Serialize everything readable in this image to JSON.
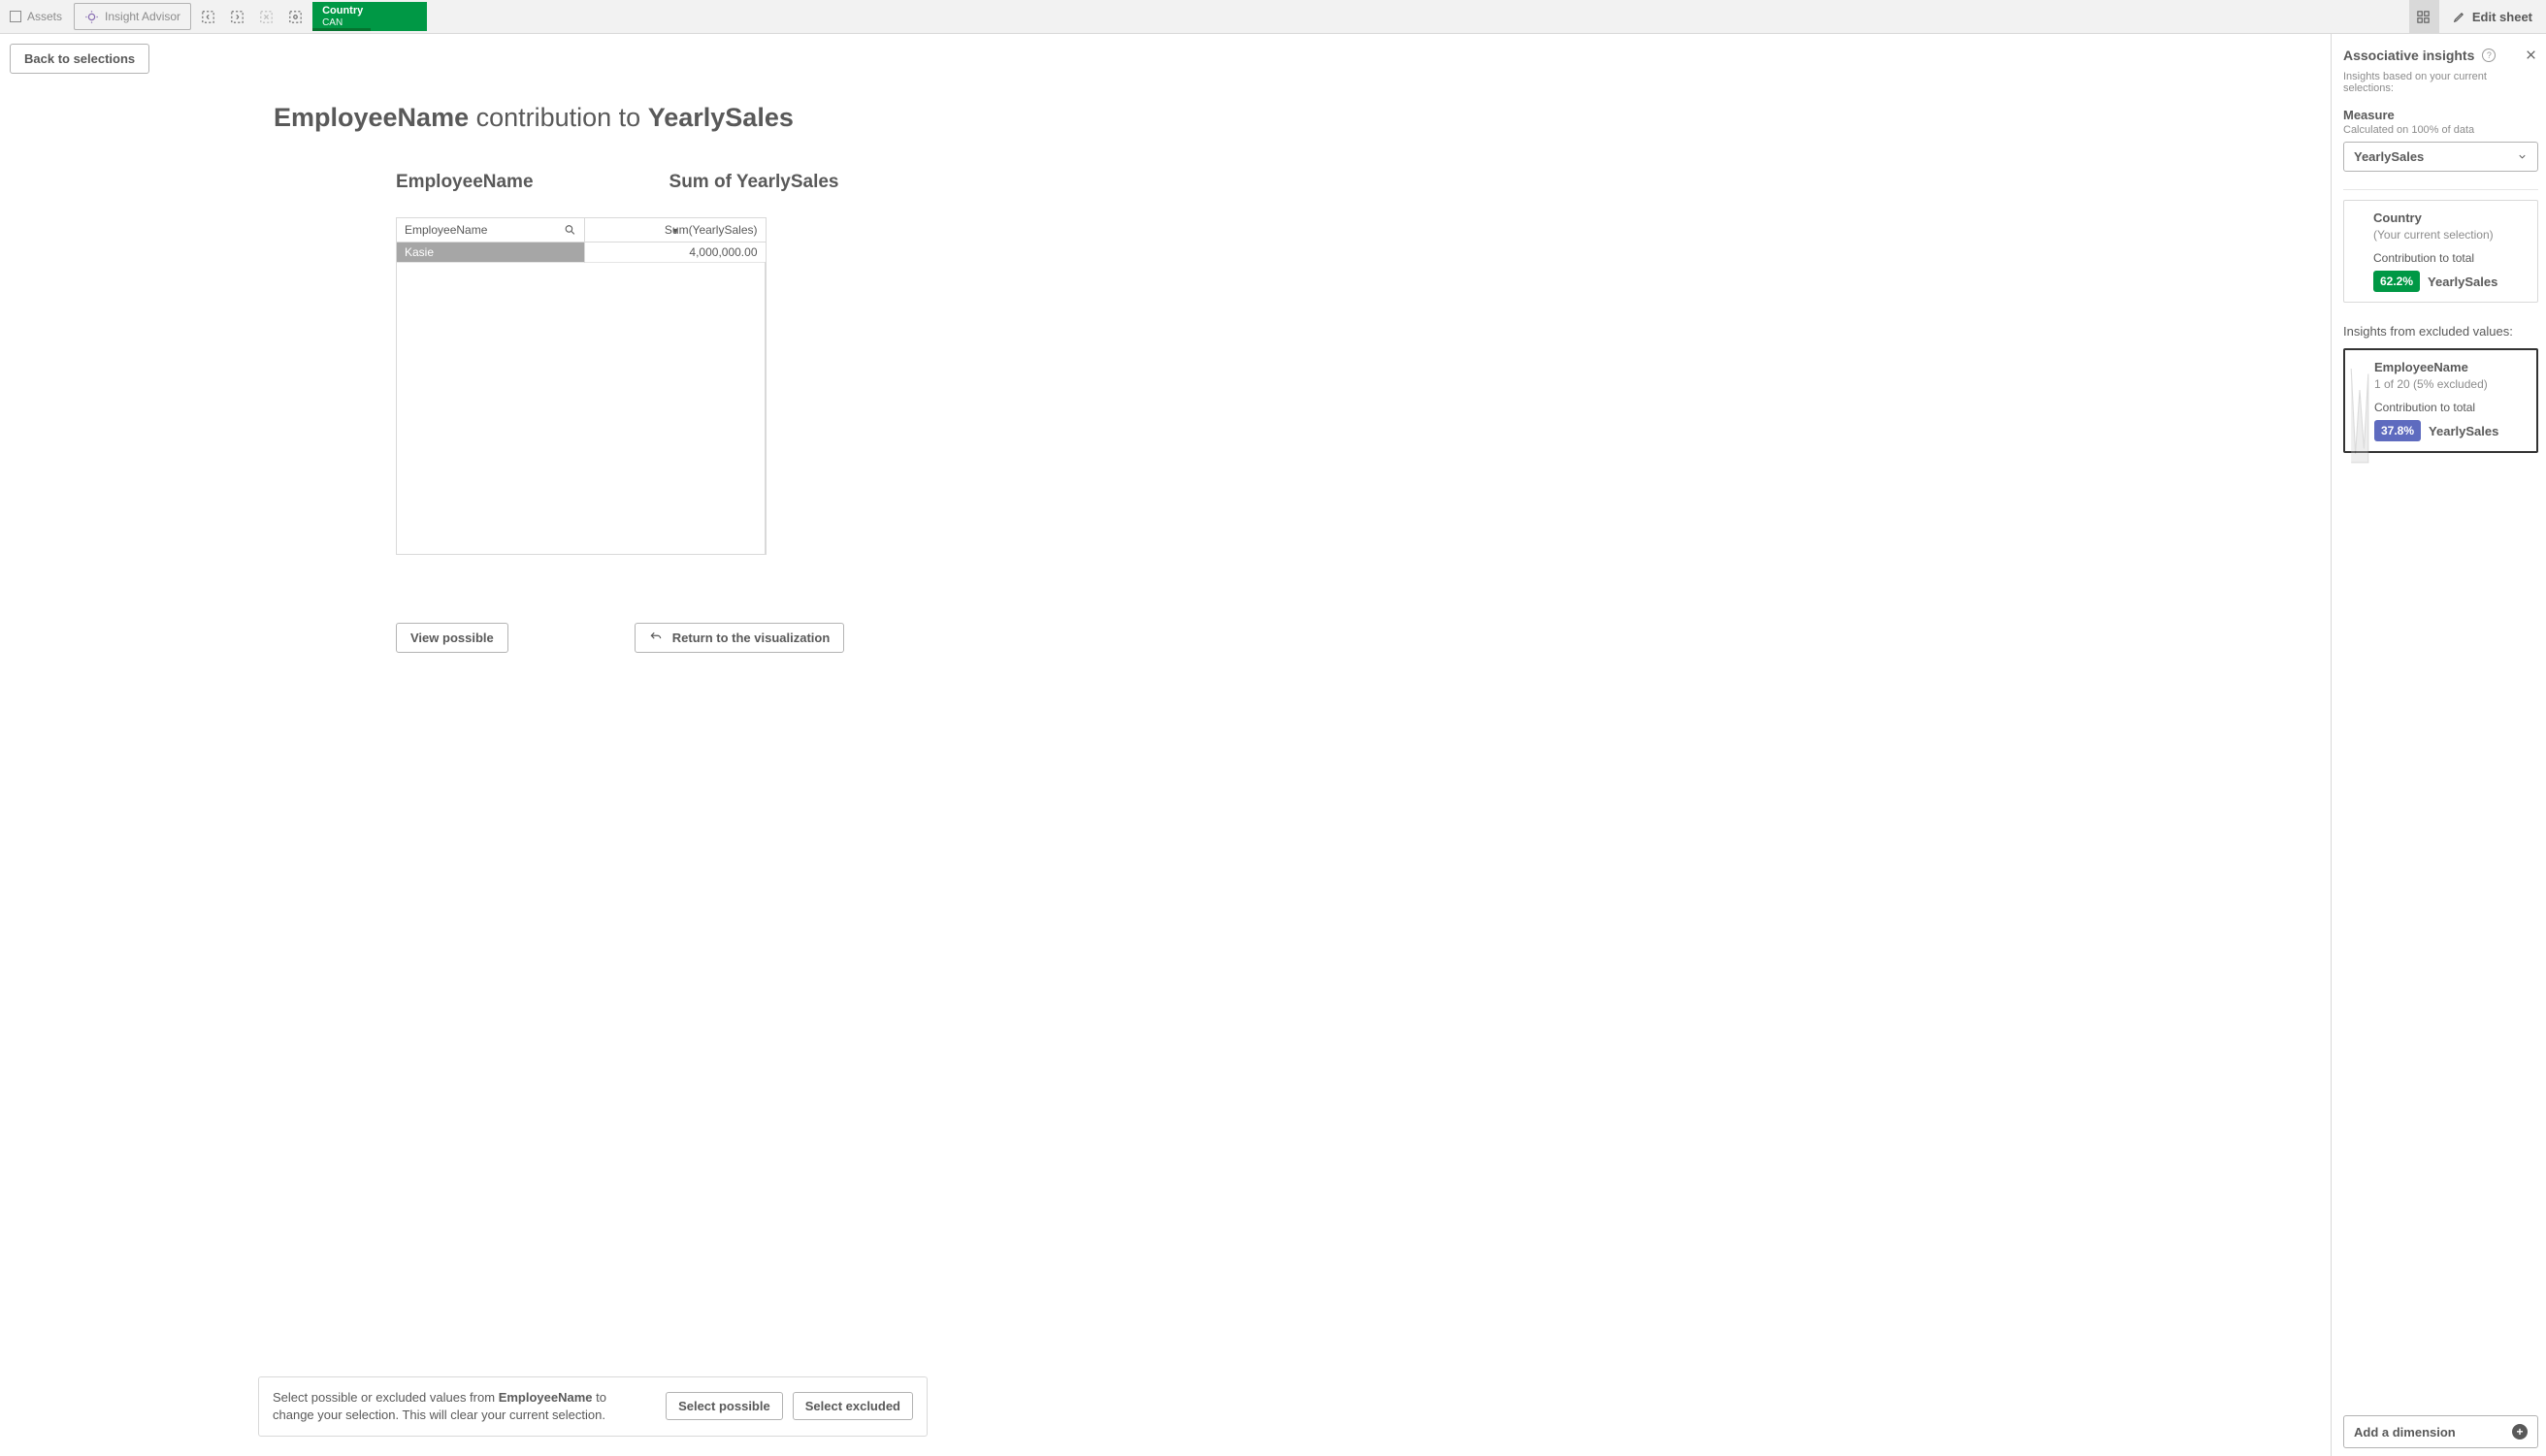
{
  "toolbar": {
    "assets_label": "Assets",
    "insight_advisor_label": "Insight Advisor",
    "selection_field": "Country",
    "selection_value": "CAN",
    "edit_sheet_label": "Edit sheet"
  },
  "content": {
    "back_button": "Back to selections",
    "title_dim": "EmployeeName",
    "title_middle": " contribution to ",
    "title_measure": "YearlySales",
    "col_header_left": "EmployeeName",
    "col_header_right": "Sum of YearlySales",
    "table_header_dim": "EmployeeName",
    "table_header_measure": "Sum(YearlySales)",
    "rows": [
      {
        "name": "Kasie",
        "value": "4,000,000.00"
      }
    ],
    "view_possible_btn": "View possible",
    "return_btn": "Return to the visualization",
    "info_text_pre": "Select possible or excluded values from ",
    "info_text_bold": "EmployeeName",
    "info_text_post": " to change your selection. This will clear your current selection.",
    "select_possible_btn": "Select possible",
    "select_excluded_btn": "Select excluded"
  },
  "panel": {
    "title": "Associative insights",
    "subtitle": "Insights based on your current selections:",
    "measure_label": "Measure",
    "measure_hint": "Calculated on 100% of data",
    "measure_value": "YearlySales",
    "current_card": {
      "title": "Country",
      "subtitle": "(Your current selection)",
      "contrib_label": "Contribution to total",
      "pct": "62.2%",
      "measure": "YearlySales"
    },
    "excluded_header": "Insights from excluded values:",
    "excluded_card": {
      "title": "EmployeeName",
      "subtitle": "1 of 20 (5% excluded)",
      "contrib_label": "Contribution to total",
      "pct": "37.8%",
      "measure": "YearlySales"
    },
    "add_dimension_label": "Add a dimension"
  }
}
